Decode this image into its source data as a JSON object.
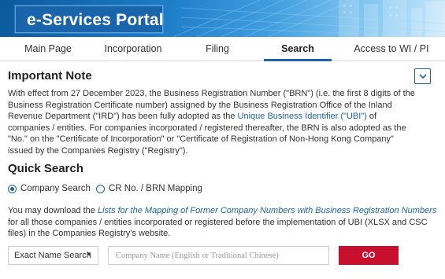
{
  "banner": {
    "title": "e-Services Portal"
  },
  "nav": {
    "tabs": [
      {
        "label": "Main Page",
        "active": false
      },
      {
        "label": "Incorporation",
        "active": false
      },
      {
        "label": "Filing",
        "active": false
      },
      {
        "label": "Search",
        "active": true
      },
      {
        "label": "Access to WI / PI",
        "active": false
      }
    ]
  },
  "important_note": {
    "title": "Important Note",
    "toggle_icon": "chevron-down-icon",
    "body_part1": "With effect from 27 December 2023, the Business Registration Number (\"BRN\") (i.e. the first 8 digits of the Business Registration Certificate number) assigned by the Business Registration Office of the Inland Revenue Department (\"IRD\") has been fully adopted as the ",
    "body_link": "Unique Business Identifier (\"UBI\")",
    "body_part2": " of companies / entities. For companies incorporated / registered thereafter, the BRN is also adopted as the \"No.\" on the \"Certificate of Incorporation\" or \"Certificate of Registration of Non-Hong Kong Company\" issued by the Companies Registry (\"Registry\")."
  },
  "quick_search": {
    "title": "Quick Search",
    "options": [
      {
        "label": "Company Search",
        "checked": true
      },
      {
        "label": "CR No. / BRN Mapping",
        "checked": false
      }
    ],
    "download_part1": "You may download the ",
    "download_link": "Lists for the Mapping of Former Company Numbers with Business Registration Numbers",
    "download_part2": " for all those companies / entities incorporated or registered before the implementation of UBI (XLSX and CSC files) in the Companies Registry's website.",
    "search_type": "Exact Name Search",
    "input_value": "",
    "input_placeholder": "Company Name (English or Traditional Chinese)",
    "go_label": "GO"
  },
  "colors": {
    "brand_blue": "#1a64ab",
    "go_red": "#c8102e",
    "link": "#1a64ab"
  }
}
